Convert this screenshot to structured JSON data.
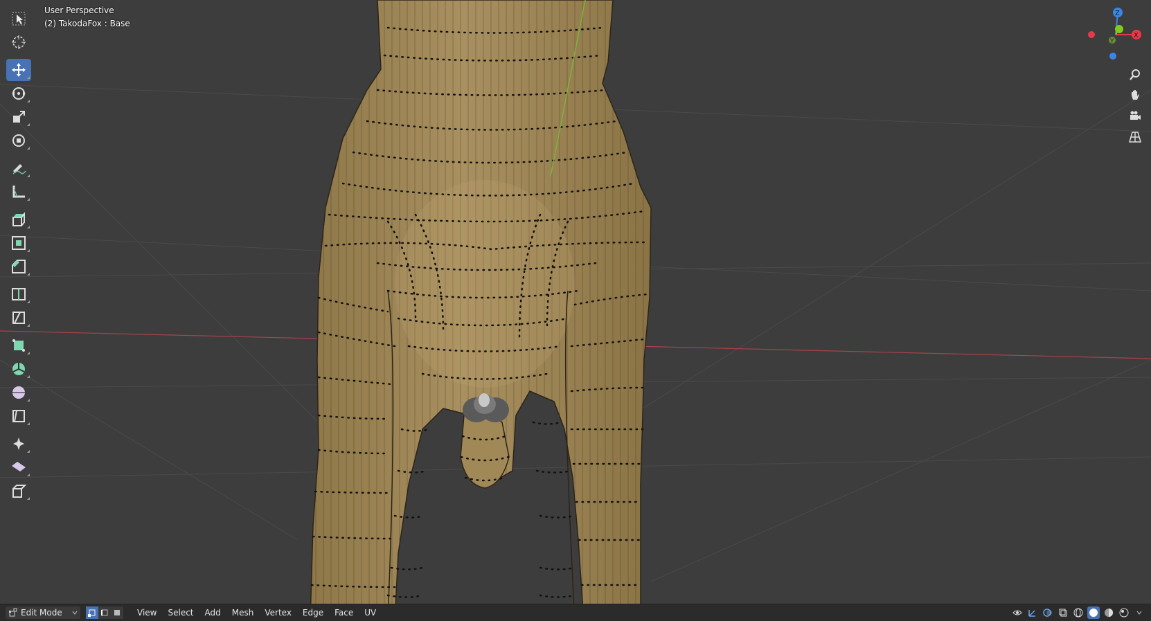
{
  "viewport": {
    "perspective_label": "User Perspective",
    "object_label": "(2) TakodaFox : Base"
  },
  "toolbar": {
    "tools": [
      {
        "name": "select-box-tool",
        "icon": "cursor-arrow-icon",
        "active": false
      },
      {
        "name": "cursor-tool",
        "icon": "crosshair-icon",
        "active": false
      },
      {
        "name": "move-tool",
        "icon": "move-arrows-icon",
        "active": true
      },
      {
        "name": "rotate-tool",
        "icon": "rotate-icon",
        "active": false
      },
      {
        "name": "scale-tool",
        "icon": "scale-icon",
        "active": false
      },
      {
        "name": "transform-tool",
        "icon": "transform-icon",
        "active": false
      },
      {
        "name": "annotate-tool",
        "icon": "pencil-icon",
        "active": false
      },
      {
        "name": "measure-tool",
        "icon": "ruler-icon",
        "active": false
      },
      {
        "name": "extrude-region-tool",
        "icon": "extrude-icon",
        "active": false
      },
      {
        "name": "inset-faces-tool",
        "icon": "inset-icon",
        "active": false
      },
      {
        "name": "bevel-tool",
        "icon": "bevel-icon",
        "active": false
      },
      {
        "name": "loop-cut-tool",
        "icon": "loop-cut-icon",
        "active": false
      },
      {
        "name": "knife-tool",
        "icon": "knife-icon",
        "active": false
      },
      {
        "name": "poly-build-tool",
        "icon": "poly-build-icon",
        "active": false
      },
      {
        "name": "spin-tool",
        "icon": "spin-icon",
        "active": false
      },
      {
        "name": "smooth-tool",
        "icon": "smooth-sphere-icon",
        "active": false
      },
      {
        "name": "edge-slide-tool",
        "icon": "edge-slide-icon",
        "active": false
      },
      {
        "name": "shrink-fatten-tool",
        "icon": "shrink-fatten-icon",
        "active": false
      },
      {
        "name": "shear-tool",
        "icon": "shear-icon",
        "active": false
      },
      {
        "name": "rip-region-tool",
        "icon": "rip-icon",
        "active": false
      }
    ]
  },
  "gizmo": {
    "x_label": "X",
    "y_label": "Y",
    "z_label": "Z",
    "colors": {
      "x": "#e8394b",
      "y": "#82c91e",
      "z": "#3a86e6"
    }
  },
  "navigation": [
    {
      "name": "zoom-button",
      "icon": "magnifier-icon"
    },
    {
      "name": "pan-button",
      "icon": "hand-icon"
    },
    {
      "name": "camera-button",
      "icon": "camera-icon"
    },
    {
      "name": "ortho-toggle-button",
      "icon": "grid-icon"
    }
  ],
  "header": {
    "mode_label": "Edit Mode",
    "menus": [
      "View",
      "Select",
      "Add",
      "Mesh",
      "Vertex",
      "Edge",
      "Face",
      "UV"
    ]
  },
  "colors": {
    "background": "#3d3d3d",
    "mesh": "#a08857",
    "accent": "#4772b3",
    "x_axis": "#c8444b",
    "seam": "#82c91e"
  }
}
